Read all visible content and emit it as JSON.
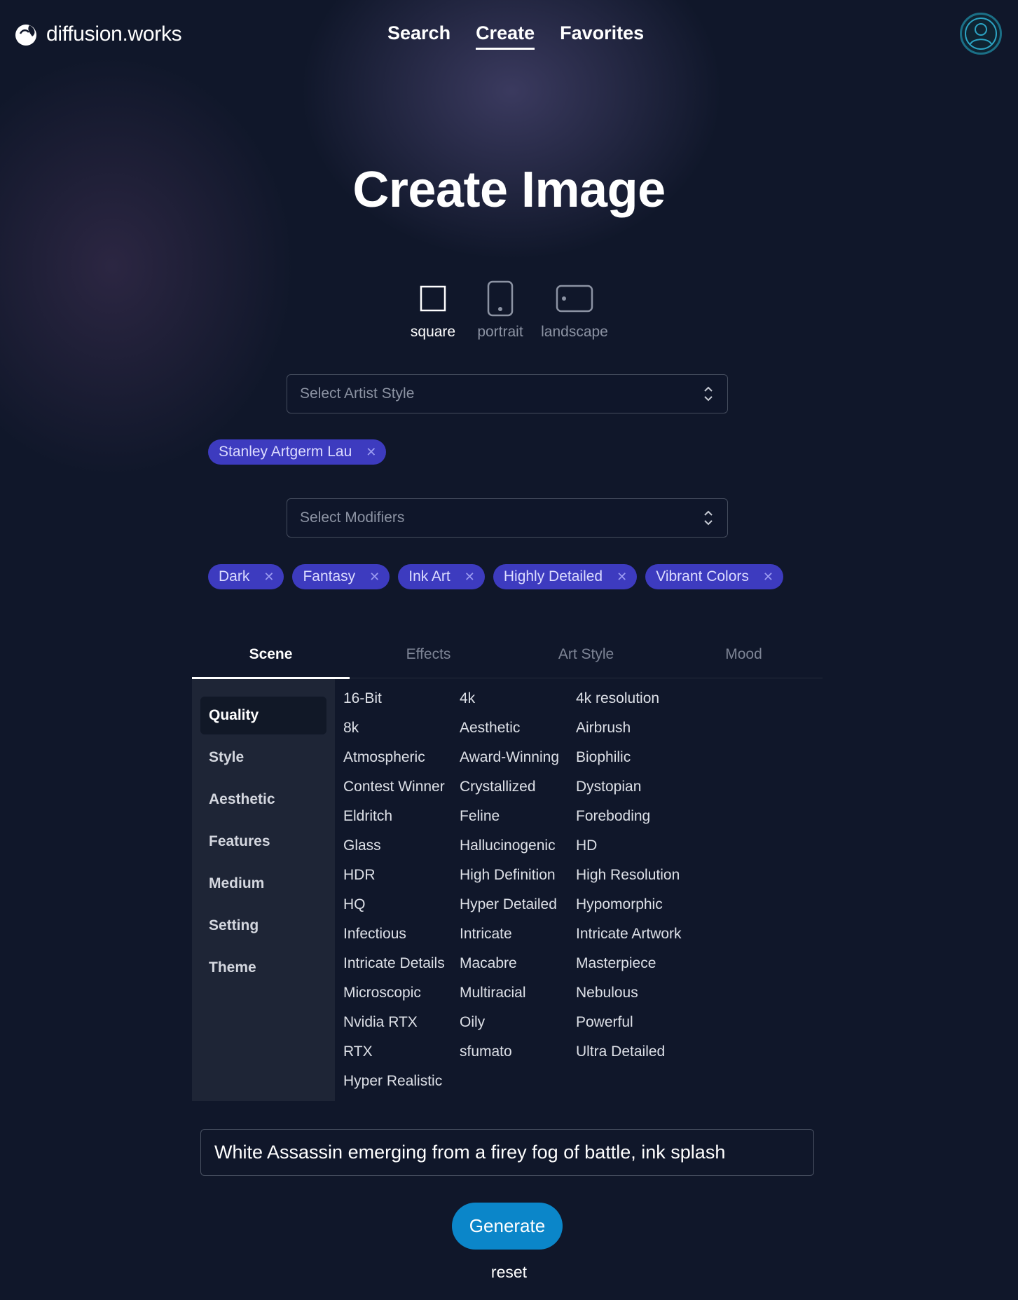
{
  "brand": {
    "name": "diffusion.works",
    "icon": "brand-logo-icon"
  },
  "nav": [
    {
      "label": "Search",
      "active": false
    },
    {
      "label": "Create",
      "active": true
    },
    {
      "label": "Favorites",
      "active": false
    }
  ],
  "user": {
    "icon": "user-avatar-icon",
    "accent": "#1b6f86"
  },
  "title": "Create Image",
  "orientations": [
    {
      "label": "square",
      "icon": "square-icon",
      "active": true
    },
    {
      "label": "portrait",
      "icon": "portrait-icon",
      "active": false
    },
    {
      "label": "landscape",
      "icon": "landscape-icon",
      "active": false
    }
  ],
  "artist_select": {
    "placeholder": "Select Artist Style"
  },
  "artist_chips": [
    {
      "label": "Stanley Artgerm Lau"
    }
  ],
  "modifier_select": {
    "placeholder": "Select Modifiers"
  },
  "modifier_chips": [
    {
      "label": "Dark"
    },
    {
      "label": "Fantasy"
    },
    {
      "label": "Ink Art"
    },
    {
      "label": "Highly Detailed"
    },
    {
      "label": "Vibrant Colors"
    }
  ],
  "chip_remove_glyph": "✕",
  "tabs": [
    {
      "label": "Scene",
      "active": true
    },
    {
      "label": "Effects",
      "active": false
    },
    {
      "label": "Art Style",
      "active": false
    },
    {
      "label": "Mood",
      "active": false
    }
  ],
  "categories": [
    {
      "label": "Quality",
      "active": true
    },
    {
      "label": "Style",
      "active": false
    },
    {
      "label": "Aesthetic",
      "active": false
    },
    {
      "label": "Features",
      "active": false
    },
    {
      "label": "Medium",
      "active": false
    },
    {
      "label": "Setting",
      "active": false
    },
    {
      "label": "Theme",
      "active": false
    }
  ],
  "modifiers": [
    "16-Bit",
    "4k",
    "4k resolution",
    "8k",
    "Aesthetic",
    "Airbrush",
    "Atmospheric",
    "Award-Winning",
    "Biophilic",
    "Contest Winner",
    "Crystallized",
    "Dystopian",
    "Eldritch",
    "Feline",
    "Foreboding",
    "Glass",
    "Hallucinogenic",
    "HD",
    "HDR",
    "High Definition",
    "High Resolution",
    "HQ",
    "Hyper Detailed",
    "Hypomorphic",
    "Infectious",
    "Intricate",
    "Intricate Artwork",
    "Intricate Details",
    "Macabre",
    "Masterpiece",
    "Microscopic",
    "Multiracial",
    "Nebulous",
    "Nvidia RTX",
    "Oily",
    "Powerful",
    "RTX",
    "sfumato",
    "Ultra Detailed",
    "Hyper Realistic"
  ],
  "prompt": {
    "value": "White Assassin emerging from a firey fog of battle, ink splash"
  },
  "generate_label": "Generate",
  "reset_label": "reset",
  "colors": {
    "chip": "#3d3bbf",
    "generate": "#0b86c9",
    "background": "#10172a"
  }
}
